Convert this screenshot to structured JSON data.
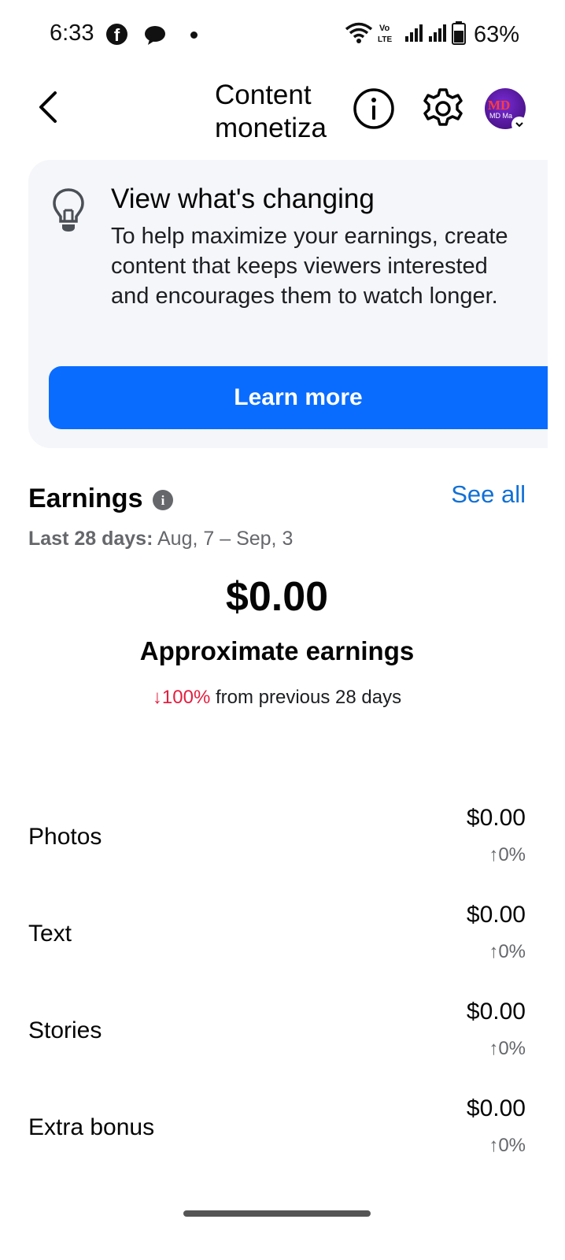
{
  "status_bar": {
    "time": "6:33",
    "battery_percent": "63%",
    "icons": [
      "facebook-icon",
      "messenger-icon",
      "notification-dot",
      "wifi-icon",
      "volte-icon",
      "signal-icon",
      "signal-icon",
      "battery-icon"
    ]
  },
  "header": {
    "title": "Content monetiza",
    "icons": [
      "back-arrow-icon",
      "info-icon",
      "gear-icon",
      "avatar"
    ],
    "avatar_text": "MD",
    "avatar_subtext": "MD Ma"
  },
  "banner": {
    "icon": "lightbulb-icon",
    "title": "View what's changing",
    "body": "To help maximize your earnings, create content that keeps viewers interested and encourages them to watch longer.",
    "button_label": "Learn more",
    "button_color": "#0a6cff"
  },
  "earnings": {
    "title": "Earnings",
    "see_all": "See all",
    "period_label": "Last 28 days:",
    "period_range": "Aug, 7 – Sep, 3",
    "total": "$0.00",
    "total_label": "Approximate earnings",
    "change": "↓100%",
    "change_suffix": "from previous 28 days",
    "negative_color": "#e41e3f",
    "link_color": "#1170d6"
  },
  "breakdown": [
    {
      "label": "Photos",
      "value": "$0.00",
      "change": "↑0%"
    },
    {
      "label": "Text",
      "value": "$0.00",
      "change": "↑0%"
    },
    {
      "label": "Stories",
      "value": "$0.00",
      "change": "↑0%"
    },
    {
      "label": "Extra bonus",
      "value": "$0.00",
      "change": "↑0%"
    }
  ]
}
